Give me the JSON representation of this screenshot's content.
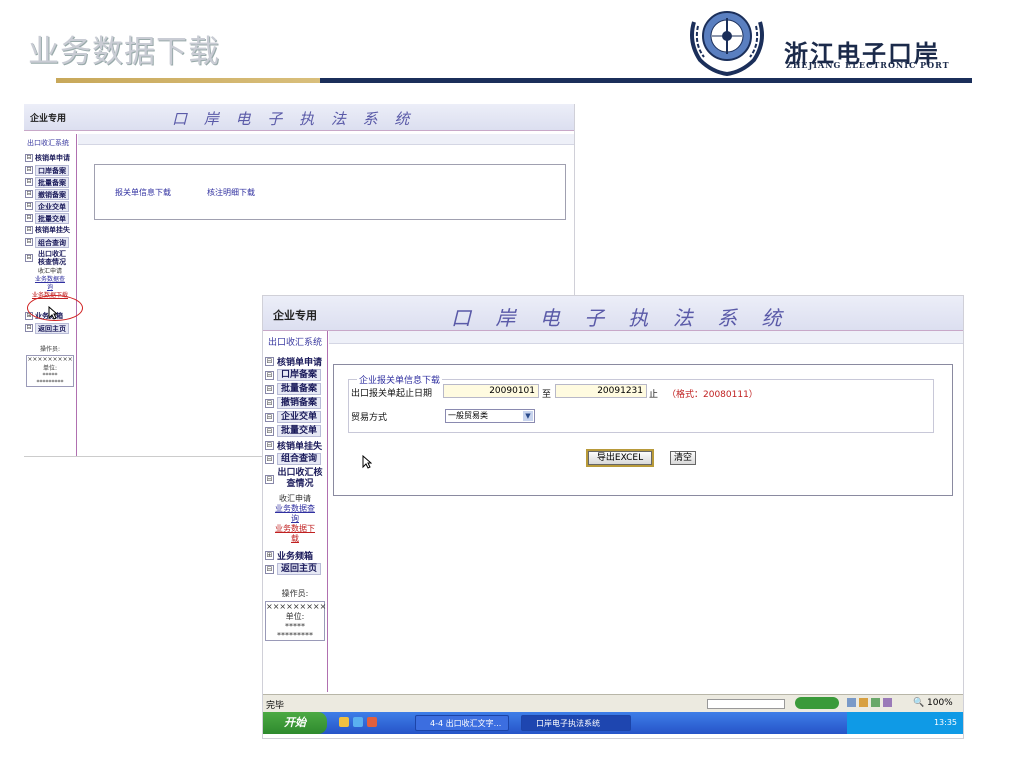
{
  "slide": {
    "title": "业务数据下载",
    "brand_cn": "浙江电子口岸",
    "brand_en": "ZHEJIANG ELECTRONIC PORT"
  },
  "app": {
    "enterprise_label": "企业专用",
    "system_title": "口 岸 电 子 执 法 系 统",
    "sidebar": {
      "system_label": "出口收汇系统",
      "items": [
        {
          "label": "核销单申请",
          "expander": "⊟"
        },
        {
          "label": "口岸备案",
          "expander": "⊟"
        },
        {
          "label": "批量备案",
          "expander": "⊟"
        },
        {
          "label": "撤销备案",
          "expander": "⊟"
        },
        {
          "label": "企业交单",
          "expander": "⊟"
        },
        {
          "label": "批量交单",
          "expander": "⊟"
        },
        {
          "label": "核销单挂失",
          "expander": "⊟"
        },
        {
          "label": "组合查询",
          "expander": "⊟"
        },
        {
          "label": "出口收汇核查情况",
          "expander": "⊟"
        }
      ],
      "subitems": {
        "apply": "收汇申请",
        "query": "业务数据查询",
        "download": "业务数据下载"
      },
      "bottom_items": [
        {
          "label": "业务频箱",
          "expander": "⊞"
        },
        {
          "label": "返回主页",
          "expander": "⊟"
        }
      ],
      "operator_label": "操作员:",
      "operator_value": "×××××××××",
      "unit_label": "单位:",
      "unit_value1": "*****",
      "unit_value2": "*********"
    }
  },
  "shot1": {
    "link_baoguan": "报关单信息下载",
    "link_biaozhu": "核注明细下载"
  },
  "shot2": {
    "form": {
      "legend": "企业报关单信息下载",
      "date_label": "出口报关单起止日期",
      "start_date": "20090101",
      "to_label": "至",
      "end_date": "20091231",
      "end_label": "止",
      "format_hint": "（格式：20080111）",
      "trade_label": "贸易方式",
      "trade_value": "一般贸易类",
      "export_button": "导出EXCEL",
      "clear_button": "清空"
    },
    "status": {
      "done": "完毕",
      "zoom": "100%"
    },
    "taskbar": {
      "start": "开始",
      "task1": "4-4 出口收汇文字...",
      "task2": "口岸电子执法系统",
      "clock": "13:35"
    }
  },
  "colors": {
    "system_title": "#5a5aa8",
    "accent_link": "#3030a0",
    "highlight_red": "#c02020",
    "gold_bar": "#c8a85a",
    "navy_bar": "#1b2f5a"
  }
}
